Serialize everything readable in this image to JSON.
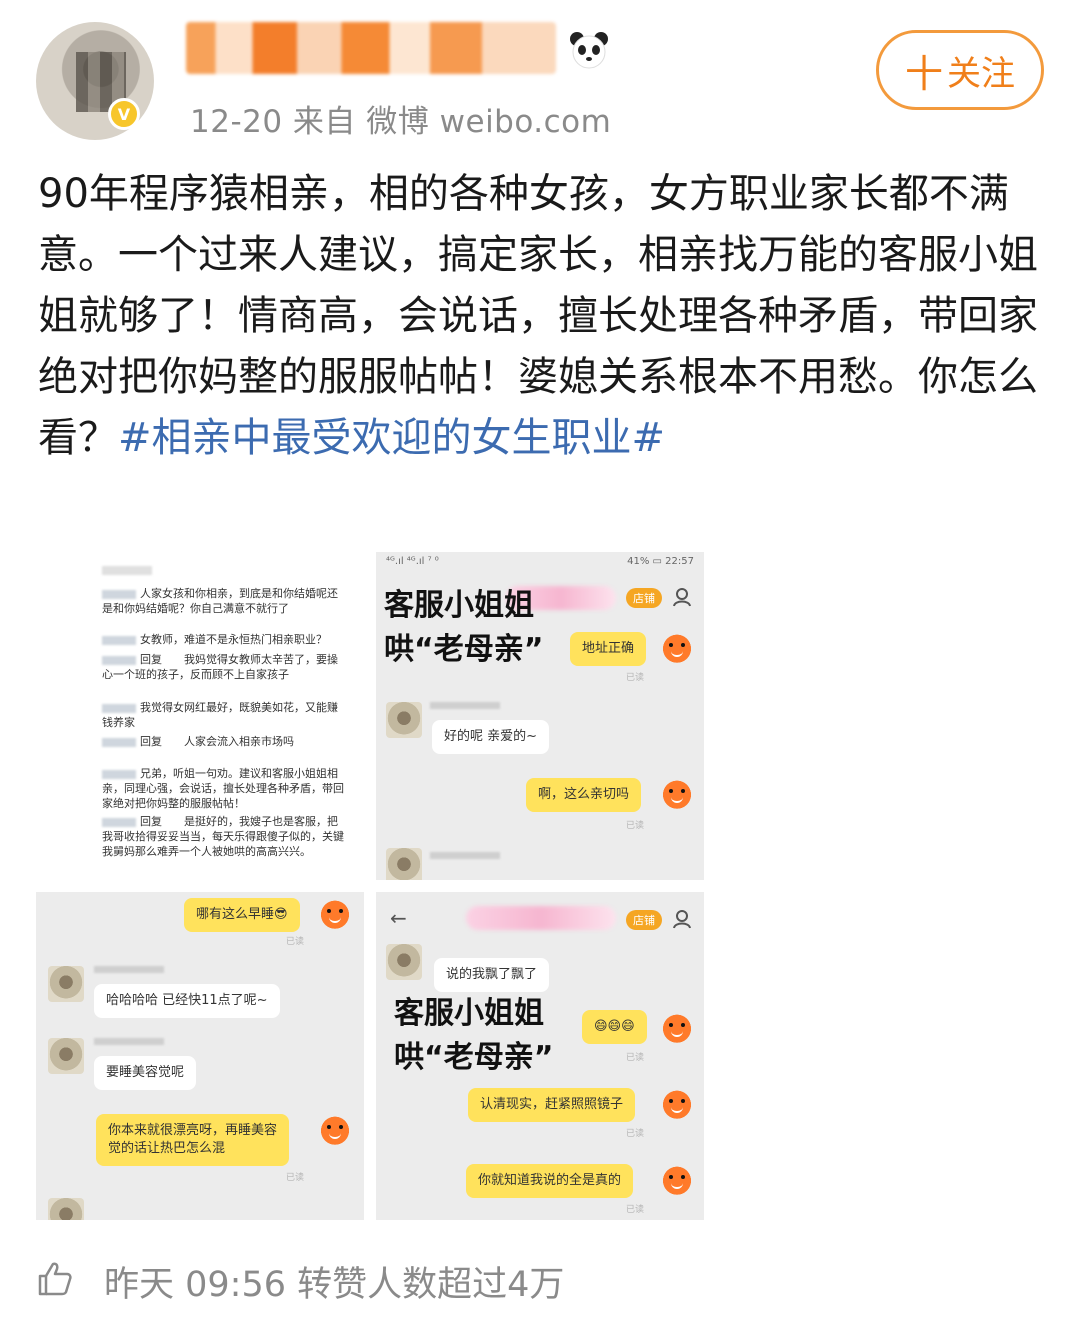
{
  "header": {
    "meta": "12-20 来自 微博 weibo.com",
    "follow_label": "关注",
    "follow_plus": "十"
  },
  "post": {
    "text": "90年程序猿相亲，相的各种女孩，女方职业家长都不满意。一个过来人建议，搞定家长，相亲找万能的客服小姐姐就够了！情商高，会说话，擅长处理各种矛盾，带回家绝对把你妈整的服服帖帖！婆媳关系根本不用愁。你怎么看？",
    "hashtag": "#相亲中最受欢迎的女生职业#"
  },
  "images": {
    "comments": [
      "人家女孩和你相亲，到底是和你结婚呢还是和你妈结婚呢？你自己满意不就行了",
      "女教师，难道不是永恒热门相亲职业？",
      "回复　　我妈觉得女教师太辛苦了，要操心一个班的孩子，反而顾不上自家孩子",
      "我觉得女网红最好，既貌美如花，又能赚钱养家",
      "回复　　人家会流入相亲市场吗",
      "兄弟，听姐一句劝。建议和客服小姐姐相亲，同理心强，会说话，擅长处理各种矛盾，带回家绝对把你妈整的服服帖帖！",
      "回复　　是挺好的，我嫂子也是客服，把我哥收拾得妥妥当当，每天乐得跟傻子似的，关键我舅妈那么难弄一个人被她哄的高高兴兴。"
    ],
    "chat1": {
      "status_left": "⁴ᴳ.ıl ⁴ᴳ.ıl ⁷ ⁰",
      "status_right": "41% ▭ 22:57",
      "shop": "店铺",
      "title_line1": "客服小姐姐",
      "title_line2": "哄“老母亲”",
      "msg1": "地址正确",
      "msg2": "好的呢 亲爱的~",
      "msg3": "啊，这么亲切吗",
      "read": "已读"
    },
    "chat2": {
      "msg1": "哪有这么早睡😎",
      "msg2": "哈哈哈哈 已经快11点了呢~",
      "msg3": "要睡美容觉呢",
      "msg4_line1": "你本来就很漂亮呀，再睡美容",
      "msg4_line2": "觉的话让热巴怎么混",
      "read": "已读"
    },
    "chat3": {
      "shop": "店铺",
      "msg1": "说的我飘了飘了",
      "title_line1": "客服小姐姐",
      "title_line2": "哄“老母亲”",
      "msg2": "😄😄😄",
      "msg3": "认清现实，赶紧照照镜子",
      "msg4": "你就知道我说的全是真的",
      "read": "已读"
    }
  },
  "footer": {
    "text": "昨天 09:56 转赞人数超过4万"
  },
  "colors": {
    "accent": "#f07f1a",
    "hashtag": "#3c6bb0",
    "meta": "#8a8a8a"
  }
}
